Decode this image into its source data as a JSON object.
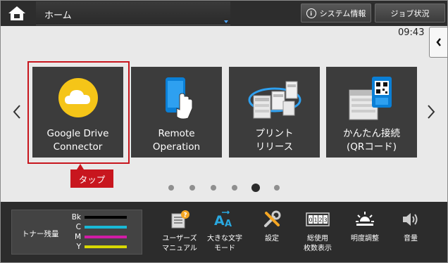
{
  "topbar": {
    "title": "ホーム",
    "system_info_label": "システム情報",
    "system_info_icon": "info-icon",
    "job_status_label": "ジョブ状況",
    "home_icon": "home-icon"
  },
  "clock": "09:43",
  "tiles": [
    {
      "line1": "Google Drive",
      "line2": "Connector",
      "icon": "cloud-icon"
    },
    {
      "line1": "Remote",
      "line2": "Operation",
      "icon": "phone-touch-icon"
    },
    {
      "line1": "プリント",
      "line2": "リリース",
      "icon": "printer-network-icon"
    },
    {
      "line1": "かんたん接続",
      "line2": "(QRコード)",
      "icon": "qr-connect-icon"
    }
  ],
  "callout": {
    "label": "タップ"
  },
  "pagination": {
    "pages": 6,
    "current": 5
  },
  "toner": {
    "label": "トナー残量",
    "colors": [
      {
        "key": "Bk",
        "color": "#000000"
      },
      {
        "key": "C",
        "color": "#19b9d6"
      },
      {
        "key": "M",
        "color": "#d11ca6"
      },
      {
        "key": "Y",
        "color": "#d8d800"
      }
    ]
  },
  "utilities": [
    {
      "line1": "ユーザーズ",
      "line2": "マニュアル",
      "icon": "manual-help-icon"
    },
    {
      "line1": "大きな文字",
      "line2": "モード",
      "icon": "large-text-icon"
    },
    {
      "line1": "設定",
      "line2": "",
      "icon": "settings-tools-icon"
    },
    {
      "line1": "総使用",
      "line2": "枚数表示",
      "icon": "counter-icon"
    },
    {
      "line1": "明度調整",
      "line2": "",
      "icon": "brightness-icon"
    },
    {
      "line1": "音量",
      "line2": "",
      "icon": "volume-icon"
    }
  ],
  "colors": {
    "accent_red": "#c8161e",
    "bar_dark": "#2d2d2d",
    "tile_bg": "#3c3c3c"
  }
}
